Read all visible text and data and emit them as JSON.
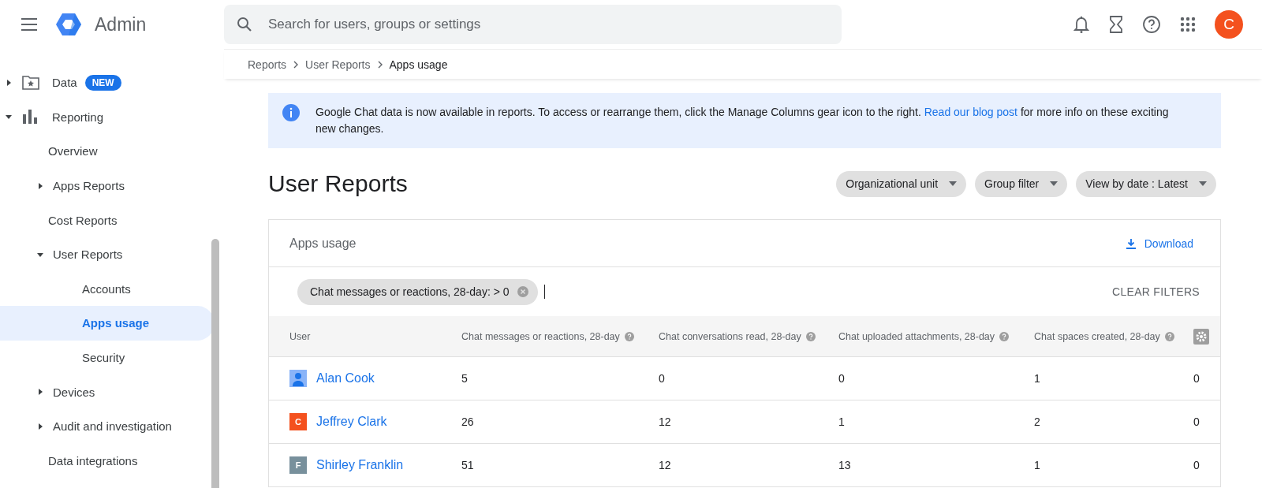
{
  "header": {
    "app_name": "Admin",
    "search": {
      "placeholder": "Search for users, groups or settings"
    },
    "avatar_letter": "C"
  },
  "sidebar": {
    "items": [
      {
        "label": "Data",
        "badge": "NEW",
        "kind": "folder",
        "expanded": false,
        "selected": false
      },
      {
        "label": "Reporting",
        "kind": "chart",
        "expanded": true,
        "selected": false,
        "children": [
          {
            "label": "Overview",
            "selected": false
          },
          {
            "label": "Apps Reports",
            "expanded": false,
            "selected": false
          },
          {
            "label": "Cost Reports",
            "selected": false
          },
          {
            "label": "User Reports",
            "expanded": true,
            "selected": false,
            "children": [
              {
                "label": "Accounts",
                "selected": false
              },
              {
                "label": "Apps usage",
                "selected": true
              },
              {
                "label": "Security",
                "selected": false
              }
            ]
          },
          {
            "label": "Devices",
            "expanded": false,
            "selected": false
          },
          {
            "label": "Audit and investigation",
            "expanded": false,
            "selected": false
          },
          {
            "label": "Data integrations",
            "selected": false
          }
        ]
      }
    ]
  },
  "breadcrumb": [
    "Reports",
    "User Reports",
    "Apps usage"
  ],
  "banner": {
    "text": "Google Chat data is now available in reports. To access or rearrange them, click the Manage Columns gear icon to the right.",
    "link": "Read our blog post",
    "text_after": "for more info on these exciting new changes."
  },
  "page_title": "User Reports",
  "filters": [
    "Organizational unit",
    "Group filter",
    "View by date : Latest"
  ],
  "panel": {
    "title": "Apps usage",
    "download": "Download",
    "filter_chip": "Chat messages or reactions, 28-day: > 0",
    "clear_filters": "CLEAR FILTERS"
  },
  "table": {
    "columns": [
      "User",
      "Chat messages or reactions, 28-day",
      "Chat conversations read, 28-day",
      "Chat uploaded attachments, 28-day",
      "Chat spaces created, 28-day"
    ],
    "rows": [
      {
        "avatar": {
          "kind": "silhouette"
        },
        "cells": [
          "Alan Cook",
          "5",
          "0",
          "0",
          "1",
          "0"
        ]
      },
      {
        "avatar": {
          "kind": "letter",
          "letter": "C",
          "color": "#f4511e"
        },
        "cells": [
          "Jeffrey Clark",
          "26",
          "12",
          "1",
          "2",
          "0"
        ]
      },
      {
        "avatar": {
          "kind": "letter",
          "letter": "F",
          "color": "#78909c"
        },
        "cells": [
          "Shirley Franklin",
          "51",
          "12",
          "13",
          "1",
          "0"
        ]
      }
    ]
  }
}
